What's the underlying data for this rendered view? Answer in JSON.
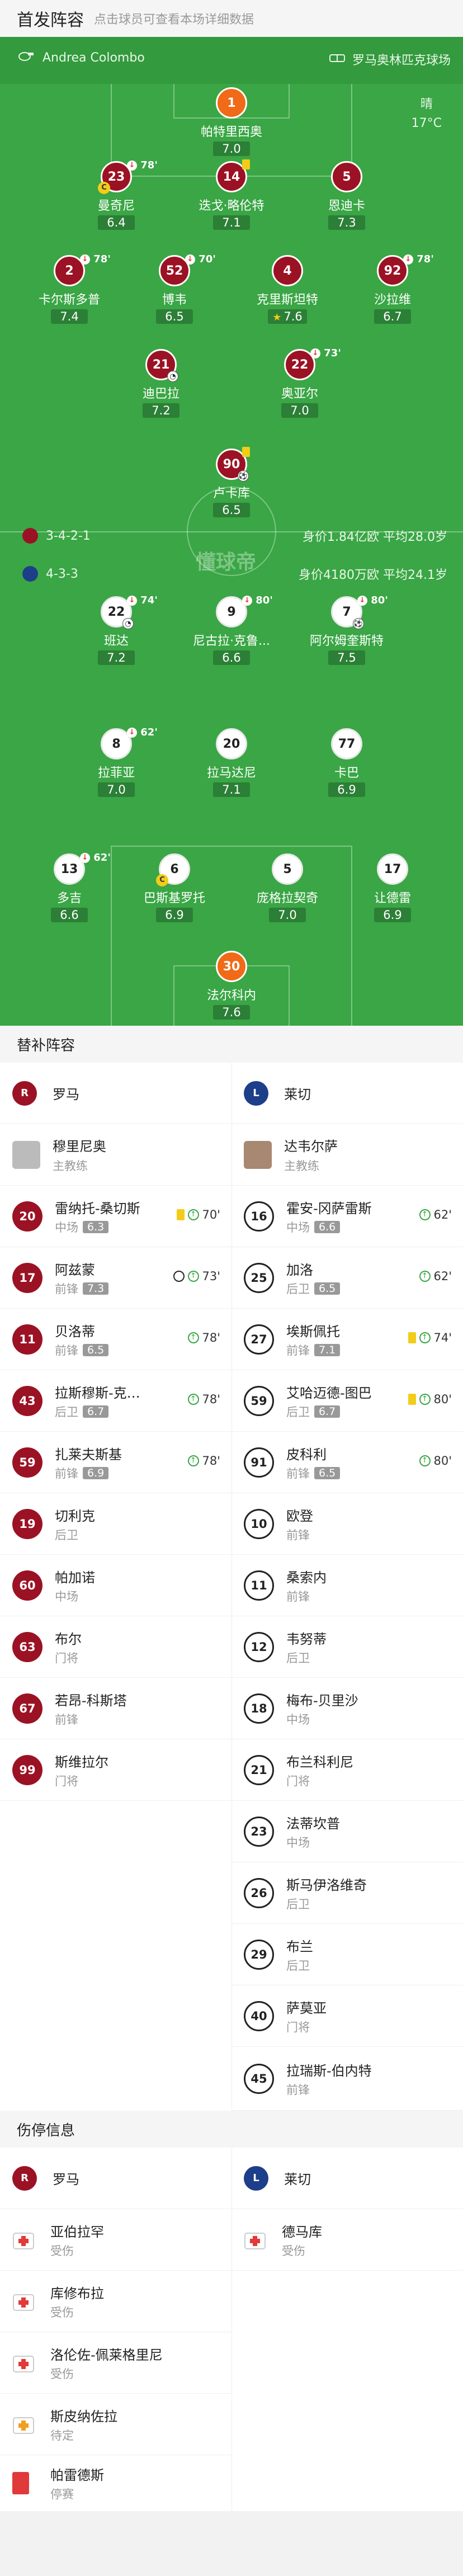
{
  "header": {
    "title": "首发阵容",
    "hint": "点击球员可查看本场详细数据"
  },
  "match": {
    "referee": "Andrea Colombo",
    "venue": "罗马奥林匹克球场",
    "weather": "晴",
    "temperature": "17°C"
  },
  "colors": {
    "roma": "#9b1224",
    "pitch": "#3aa645",
    "keeper": "#f06a17",
    "lecce_white": "#ffffff"
  },
  "home": {
    "formation": "3-4-2-1",
    "stats": "身价1.84亿欧  平均28.0岁",
    "players": [
      {
        "num": "1",
        "name": "帕特里西奥",
        "rating": "7.0"
      },
      {
        "num": "23",
        "name": "曼奇尼",
        "rating": "6.4",
        "sub": "78'"
      },
      {
        "num": "14",
        "name": "迭戈·略伦特",
        "rating": "7.1"
      },
      {
        "num": "5",
        "name": "恩迪卡",
        "rating": "7.3"
      },
      {
        "num": "2",
        "name": "卡尔斯多普",
        "rating": "7.4",
        "sub": "78'"
      },
      {
        "num": "52",
        "name": "博韦",
        "rating": "6.5",
        "sub": "70'"
      },
      {
        "num": "4",
        "name": "克里斯坦特",
        "rating": "7.6"
      },
      {
        "num": "92",
        "name": "沙拉维",
        "rating": "6.7",
        "sub": "78'"
      },
      {
        "num": "21",
        "name": "迪巴拉",
        "rating": "7.2"
      },
      {
        "num": "22",
        "name": "奥亚尔",
        "rating": "7.0",
        "sub": "73'"
      },
      {
        "num": "90",
        "name": "卢卡库",
        "rating": "6.5"
      }
    ]
  },
  "away": {
    "formation": "4-3-3",
    "stats": "身价4180万欧  平均24.1岁",
    "players": [
      {
        "num": "22",
        "name": "班达",
        "rating": "7.2",
        "sub": "74'"
      },
      {
        "num": "9",
        "name": "尼古拉·克鲁...",
        "rating": "6.6",
        "sub": "80'"
      },
      {
        "num": "7",
        "name": "阿尔姆奎斯特",
        "rating": "7.5",
        "sub": "80'"
      },
      {
        "num": "8",
        "name": "拉菲亚",
        "rating": "7.0",
        "sub": "62'"
      },
      {
        "num": "20",
        "name": "拉马达尼",
        "rating": "7.1"
      },
      {
        "num": "77",
        "name": "卡巴",
        "rating": "6.9"
      },
      {
        "num": "13",
        "name": "多吉",
        "rating": "6.6",
        "sub": "62'"
      },
      {
        "num": "6",
        "name": "巴斯基罗托",
        "rating": "6.9"
      },
      {
        "num": "5",
        "name": "庞格拉契奇",
        "rating": "7.0"
      },
      {
        "num": "17",
        "name": "让德雷",
        "rating": "6.9"
      },
      {
        "num": "30",
        "name": "法尔科内",
        "rating": "7.6"
      }
    ]
  },
  "watermark": "懂球帝",
  "subs": {
    "title": "替补阵容",
    "home_team": "罗马",
    "away_team": "莱切",
    "home_coach": {
      "name": "穆里尼奥",
      "role": "主教练"
    },
    "away_coach": {
      "name": "达韦尔萨",
      "role": "主教练"
    },
    "home": [
      {
        "num": "20",
        "name": "雷纳托-桑切斯",
        "pos": "中场",
        "rating": "6.3",
        "event": "70'"
      },
      {
        "num": "17",
        "name": "阿兹蒙",
        "pos": "前锋",
        "rating": "7.3",
        "event": "73'"
      },
      {
        "num": "11",
        "name": "贝洛蒂",
        "pos": "前锋",
        "rating": "6.5",
        "event": "78'"
      },
      {
        "num": "43",
        "name": "拉斯穆斯-克…",
        "pos": "后卫",
        "rating": "6.7",
        "event": "78'"
      },
      {
        "num": "59",
        "name": "扎莱夫斯基",
        "pos": "前锋",
        "rating": "6.9",
        "event": "78'"
      },
      {
        "num": "19",
        "name": "切利克",
        "pos": "后卫"
      },
      {
        "num": "60",
        "name": "帕加诺",
        "pos": "中场"
      },
      {
        "num": "63",
        "name": "布尔",
        "pos": "门将"
      },
      {
        "num": "67",
        "name": "若昂-科斯塔",
        "pos": "前锋"
      },
      {
        "num": "99",
        "name": "斯维拉尔",
        "pos": "门将"
      }
    ],
    "away": [
      {
        "num": "16",
        "name": "霍安-冈萨雷斯",
        "pos": "中场",
        "rating": "6.6",
        "event": "62'"
      },
      {
        "num": "25",
        "name": "加洛",
        "pos": "后卫",
        "rating": "6.5",
        "event": "62'"
      },
      {
        "num": "27",
        "name": "埃斯佩托",
        "pos": "前锋",
        "rating": "7.1",
        "event": "74'"
      },
      {
        "num": "59",
        "name": "艾哈迈德-图巴",
        "pos": "后卫",
        "rating": "6.7",
        "event": "80'"
      },
      {
        "num": "91",
        "name": "皮科利",
        "pos": "前锋",
        "rating": "6.5",
        "event": "80'"
      },
      {
        "num": "10",
        "name": "欧登",
        "pos": "前锋"
      },
      {
        "num": "11",
        "name": "桑索内",
        "pos": "前锋"
      },
      {
        "num": "12",
        "name": "韦努蒂",
        "pos": "后卫"
      },
      {
        "num": "18",
        "name": "梅布-贝里沙",
        "pos": "中场"
      },
      {
        "num": "21",
        "name": "布兰科利尼",
        "pos": "门将"
      },
      {
        "num": "23",
        "name": "法蒂坎普",
        "pos": "中场"
      },
      {
        "num": "26",
        "name": "斯马伊洛维奇",
        "pos": "后卫"
      },
      {
        "num": "29",
        "name": "布兰",
        "pos": "后卫"
      },
      {
        "num": "40",
        "name": "萨莫亚",
        "pos": "门将"
      },
      {
        "num": "45",
        "name": "拉瑞斯-伯内特",
        "pos": "前锋"
      }
    ]
  },
  "injuries": {
    "title": "伤停信息",
    "home_team": "罗马",
    "away_team": "莱切",
    "home": [
      {
        "name": "亚伯拉罕",
        "status": "受伤"
      },
      {
        "name": "库修布拉",
        "status": "受伤"
      },
      {
        "name": "洛伦佐-佩莱格里尼",
        "status": "受伤"
      },
      {
        "name": "斯皮纳佐拉",
        "status": "待定"
      },
      {
        "name": "帕雷德斯",
        "status": "停赛"
      }
    ],
    "away": [
      {
        "name": "德马库",
        "status": "受伤"
      }
    ]
  }
}
